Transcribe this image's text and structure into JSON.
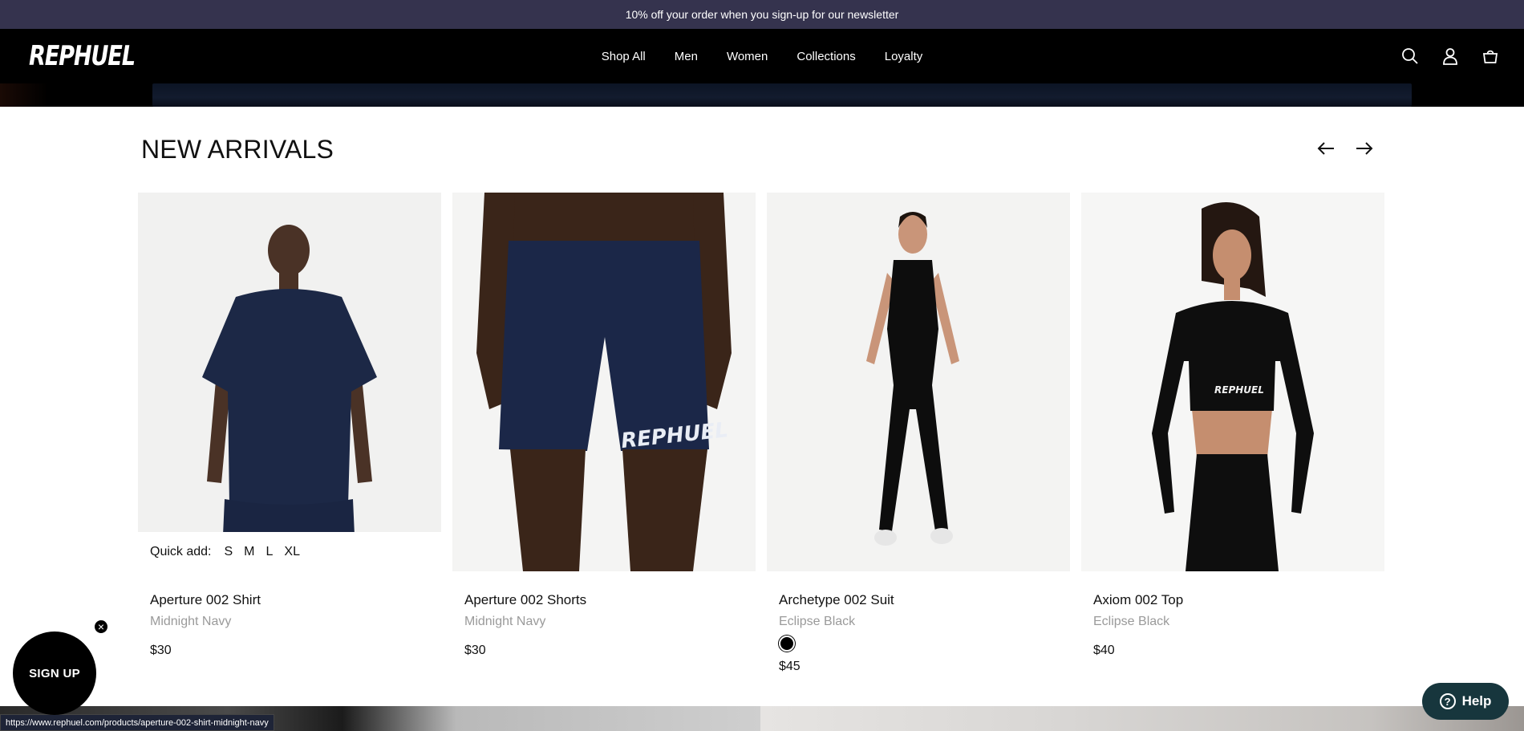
{
  "announcement": "10% off your order when you sign-up for our newsletter",
  "header": {
    "logo": "REPHUEL",
    "nav": [
      "Shop All",
      "Men",
      "Women",
      "Collections",
      "Loyalty"
    ],
    "icons": [
      "search-icon",
      "account-icon",
      "cart-icon"
    ]
  },
  "section": {
    "title": "NEW ARRIVALS",
    "prev_icon": "arrow-left-icon",
    "next_icon": "arrow-right-icon"
  },
  "products": [
    {
      "name": "Aperture 002 Shirt",
      "color": "Midnight Navy",
      "price": "$30"
    },
    {
      "name": "Aperture 002 Shorts",
      "color": "Midnight Navy",
      "price": "$30"
    },
    {
      "name": "Archetype 002 Suit",
      "color": "Eclipse Black",
      "price": "$45"
    },
    {
      "name": "Axiom 002 Top",
      "color": "Eclipse Black",
      "price": "$40"
    }
  ],
  "quick_add": {
    "label": "Quick add:",
    "sizes": [
      "S",
      "M",
      "L",
      "XL"
    ]
  },
  "status_url": "https://www.rephuel.com/products/aperture-002-shirt-midnight-navy",
  "signup_label": "SIGN UP",
  "signup_close": "×",
  "help_label": "Help",
  "help_mark": "?",
  "image_text": "REPHUEL",
  "colors": {
    "announcement_bg": "#35334e",
    "header_bg": "#000000",
    "navy": "#1c2846",
    "help_bg": "#17363d",
    "swatch": "#000000"
  }
}
